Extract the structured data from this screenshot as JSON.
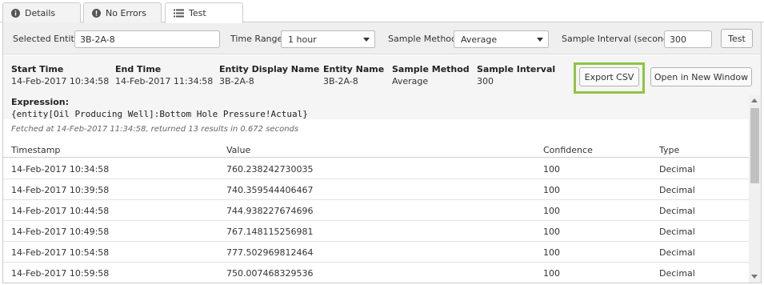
{
  "tabs": [
    {
      "label": "Details",
      "icon": "info-icon"
    },
    {
      "label": "No Errors",
      "icon": "alert-icon"
    },
    {
      "label": "Test",
      "icon": "list-icon",
      "active": true
    }
  ],
  "toolbar": {
    "selected_entity_label": "Selected Entity",
    "selected_entity_value": "3B-2A-8",
    "time_range_label": "Time Range",
    "time_range_value": "1 hour",
    "sample_method_label": "Sample Method",
    "sample_method_value": "Average",
    "sample_interval_label": "Sample Interval (seconds)",
    "sample_interval_value": "300",
    "test_button": "Test"
  },
  "info": {
    "start_time_label": "Start Time",
    "start_time_value": "14-Feb-2017 10:34:58",
    "end_time_label": "End Time",
    "end_time_value": "14-Feb-2017 11:34:58",
    "entity_display_name_label": "Entity Display Name",
    "entity_display_name_value": "3B-2A-8",
    "entity_name_label": "Entity Name",
    "entity_name_value": "3B-2A-8",
    "sample_method_label": "Sample Method",
    "sample_method_value": "Average",
    "sample_interval_label": "Sample Interval",
    "sample_interval_value": "300",
    "export_button": "Export CSV",
    "open_window_button": "Open in New Window",
    "highlight_color": "#8dc63f"
  },
  "expression": {
    "label": "Expression:",
    "text": "{entity[Oil Producing Well]:Bottom Hole Pressure!Actual}",
    "fetched": "Fetched at 14-Feb-2017 11:34:58, returned 13 results in 0.672 seconds"
  },
  "table": {
    "headers": [
      "Timestamp",
      "Value",
      "Confidence",
      "Type"
    ],
    "rows": [
      [
        "14-Feb-2017 10:34:58",
        "760.238242730035",
        "100",
        "Decimal"
      ],
      [
        "14-Feb-2017 10:39:58",
        "740.359544406467",
        "100",
        "Decimal"
      ],
      [
        "14-Feb-2017 10:44:58",
        "744.938227674696",
        "100",
        "Decimal"
      ],
      [
        "14-Feb-2017 10:49:58",
        "767.148115256981",
        "100",
        "Decimal"
      ],
      [
        "14-Feb-2017 10:54:58",
        "777.502969812464",
        "100",
        "Decimal"
      ],
      [
        "14-Feb-2017 10:59:58",
        "750.007468329536",
        "100",
        "Decimal"
      ]
    ]
  }
}
